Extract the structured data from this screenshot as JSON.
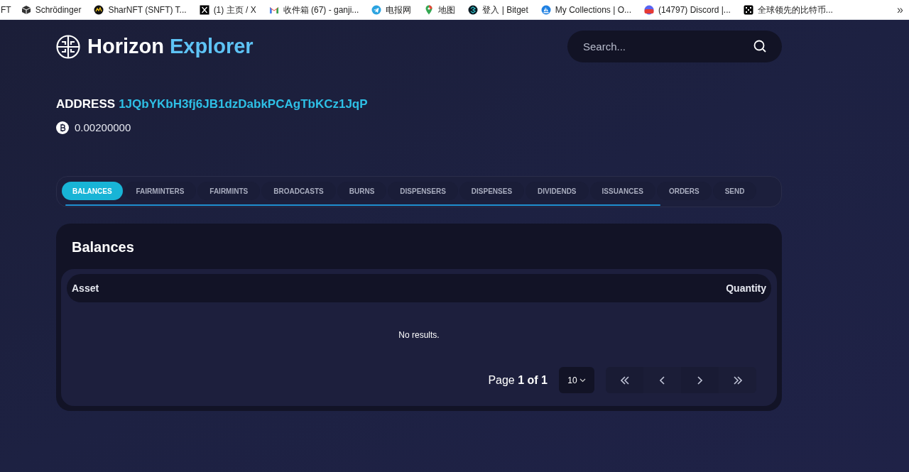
{
  "bookmarks": [
    {
      "label": "FT"
    },
    {
      "label": "Schrödinger"
    },
    {
      "label": "SharNFT (SNFT) T..."
    },
    {
      "label": "(1) 主页 / X"
    },
    {
      "label": "收件箱 (67) - ganji..."
    },
    {
      "label": "电报网"
    },
    {
      "label": "地图"
    },
    {
      "label": "登入 | Bitget"
    },
    {
      "label": "My Collections | O..."
    },
    {
      "label": "(14797) Discord |..."
    },
    {
      "label": "全球领先的比特币..."
    }
  ],
  "bookmarks_overflow": "»",
  "brand": {
    "name": "Horizon",
    "accent": "Explorer"
  },
  "search": {
    "placeholder": "Search..."
  },
  "address": {
    "label": "ADDRESS",
    "value": "1JQbYKbH3fj6JB1dzDabkPCAgTbKCz1JqP"
  },
  "balance": "0.00200000",
  "tabs": [
    {
      "label": "BALANCES",
      "selected": true
    },
    {
      "label": "FAIRMINTERS",
      "selected": false
    },
    {
      "label": "FAIRMINTS",
      "selected": false
    },
    {
      "label": "BROADCASTS",
      "selected": false
    },
    {
      "label": "BURNS",
      "selected": false
    },
    {
      "label": "DISPENSERS",
      "selected": false
    },
    {
      "label": "DISPENSES",
      "selected": false
    },
    {
      "label": "DIVIDENDS",
      "selected": false
    },
    {
      "label": "ISSUANCES",
      "selected": false
    },
    {
      "label": "ORDERS",
      "selected": false
    },
    {
      "label": "SEND",
      "selected": false
    }
  ],
  "panel": {
    "title": "Balances",
    "columns": [
      "Asset",
      "Quantity"
    ],
    "empty": "No results."
  },
  "pagination": {
    "page": "Page **1 of 1**",
    "page_size": "10"
  }
}
